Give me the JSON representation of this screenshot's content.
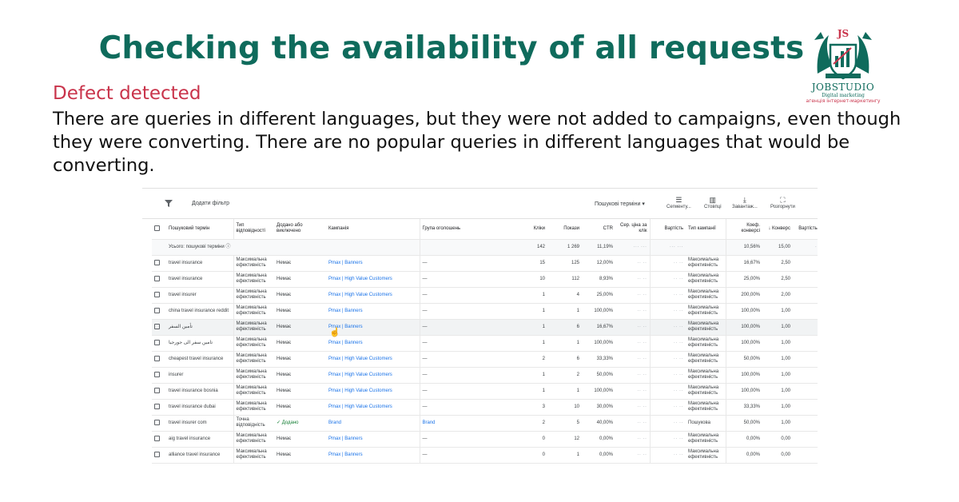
{
  "slide": {
    "title": "Checking the availability of all requests",
    "defect_label": "Defect detected",
    "description": "There are queries in different languages, but they were not added to campaigns, even though they were converting. There are no popular queries in different languages that would be converting."
  },
  "logo": {
    "initials": "JS",
    "name": "JOBSTUDIO",
    "subtitle": "Digital marketing",
    "subtitle2": "агенція інтернет-маркетингу",
    "colors": {
      "primary": "#0f6b5c",
      "accent": "#c9344b"
    }
  },
  "toolbar": {
    "add_filter": "Додати фільтр",
    "dropdown": "Пошукові терміни",
    "tools": [
      {
        "icon": "segment-icon",
        "glyph": "☰",
        "label": "Сегменту..."
      },
      {
        "icon": "columns-icon",
        "glyph": "▥",
        "label": "Стовпці"
      },
      {
        "icon": "download-icon",
        "glyph": "⤓",
        "label": "Завантаж..."
      },
      {
        "icon": "expand-icon",
        "glyph": "⛶",
        "label": "Розгорнути"
      }
    ]
  },
  "table": {
    "columns": [
      "Пошуковий термін",
      "Тип відповідності",
      "Додано або виключено",
      "Кампанія",
      "Група оголошень",
      "Кліки",
      "Покази",
      "CTR",
      "Сер. ціна за клік",
      "Вартість",
      "Тип кампанії",
      "Коеф. конверсі",
      "Конверс",
      "Вартість конв"
    ],
    "total": {
      "label": "Усього: пошукові терміни",
      "clicks": "142",
      "impressions": "1 269",
      "ctr": "11,19%",
      "conv_rate": "10,56%",
      "conversions": "15,00"
    },
    "rows": [
      {
        "term": "travel insurance",
        "match": "Максимальна ефективність",
        "added": "Немає",
        "campaign": "Pmax | Banners",
        "group": "—",
        "clicks": "15",
        "impr": "125",
        "ctr": "12,00%",
        "ctype": "Максимальна ефективність",
        "conv_rate": "16,67%",
        "conv": "2,50"
      },
      {
        "term": "travel insurance",
        "match": "Максимальна ефективність",
        "added": "Немає",
        "campaign": "Pmax | High Value Customers",
        "group": "—",
        "clicks": "10",
        "impr": "112",
        "ctr": "8,93%",
        "ctype": "Максимальна ефективність",
        "conv_rate": "25,00%",
        "conv": "2,50"
      },
      {
        "term": "travel insurer",
        "match": "Максимальна ефективність",
        "added": "Немає",
        "campaign": "Pmax | High Value Customers",
        "group": "—",
        "clicks": "1",
        "impr": "4",
        "ctr": "25,00%",
        "ctype": "Максимальна ефективність",
        "conv_rate": "200,00%",
        "conv": "2,00"
      },
      {
        "term": "china travel insurance reddit",
        "match": "Максимальна ефективність",
        "added": "Немає",
        "campaign": "Pmax | Banners",
        "group": "—",
        "clicks": "1",
        "impr": "1",
        "ctr": "100,00%",
        "ctype": "Максимальна ефективність",
        "conv_rate": "100,00%",
        "conv": "1,00"
      },
      {
        "term": "تأمين السفر",
        "match": "Максимальна ефективність",
        "added": "Немає",
        "campaign": "Pmax | Banners",
        "group": "—",
        "clicks": "1",
        "impr": "6",
        "ctr": "16,67%",
        "ctype": "Максимальна ефективність",
        "conv_rate": "100,00%",
        "conv": "1,00"
      },
      {
        "term": "تامين سفر الى جورجيا",
        "match": "Максимальна ефективність",
        "added": "Немає",
        "campaign": "Pmax | Banners",
        "group": "—",
        "clicks": "1",
        "impr": "1",
        "ctr": "100,00%",
        "ctype": "Максимальна ефективність",
        "conv_rate": "100,00%",
        "conv": "1,00"
      },
      {
        "term": "cheapest travel insurance",
        "match": "Максимальна ефективність",
        "added": "Немає",
        "campaign": "Pmax | High Value Customers",
        "group": "—",
        "clicks": "2",
        "impr": "6",
        "ctr": "33,33%",
        "ctype": "Максимальна ефективність",
        "conv_rate": "50,00%",
        "conv": "1,00"
      },
      {
        "term": "insurer",
        "match": "Максимальна ефективність",
        "added": "Немає",
        "campaign": "Pmax | High Value Customers",
        "group": "—",
        "clicks": "1",
        "impr": "2",
        "ctr": "50,00%",
        "ctype": "Максимальна ефективність",
        "conv_rate": "100,00%",
        "conv": "1,00"
      },
      {
        "term": "travel insurance bosnia",
        "match": "Максимальна ефективність",
        "added": "Немає",
        "campaign": "Pmax | High Value Customers",
        "group": "—",
        "clicks": "1",
        "impr": "1",
        "ctr": "100,00%",
        "ctype": "Максимальна ефективність",
        "conv_rate": "100,00%",
        "conv": "1,00"
      },
      {
        "term": "travel insurance dubai",
        "match": "Максимальна ефективність",
        "added": "Немає",
        "campaign": "Pmax | High Value Customers",
        "group": "—",
        "clicks": "3",
        "impr": "10",
        "ctr": "30,00%",
        "ctype": "Максимальна ефективність",
        "conv_rate": "33,33%",
        "conv": "1,00"
      },
      {
        "term": "travel insurer com",
        "match": "Точна відповідність",
        "added": "✓ Додано",
        "campaign": "Brand",
        "group": "Brand",
        "clicks": "2",
        "impr": "5",
        "ctr": "40,00%",
        "ctype": "Пошукова",
        "conv_rate": "50,00%",
        "conv": "1,00"
      },
      {
        "term": "aig travel insurance",
        "match": "Максимальна ефективність",
        "added": "Немає",
        "campaign": "Pmax | Banners",
        "group": "—",
        "clicks": "0",
        "impr": "12",
        "ctr": "0,00%",
        "ctype": "Максимальна ефективність",
        "conv_rate": "0,00%",
        "conv": "0,00"
      },
      {
        "term": "alliance travel insurance",
        "match": "Максимальна ефективність",
        "added": "Немає",
        "campaign": "Pmax | Banners",
        "group": "—",
        "clicks": "0",
        "impr": "1",
        "ctr": "0,00%",
        "ctype": "Максимальна ефективність",
        "conv_rate": "0,00%",
        "conv": "0,00"
      }
    ]
  }
}
